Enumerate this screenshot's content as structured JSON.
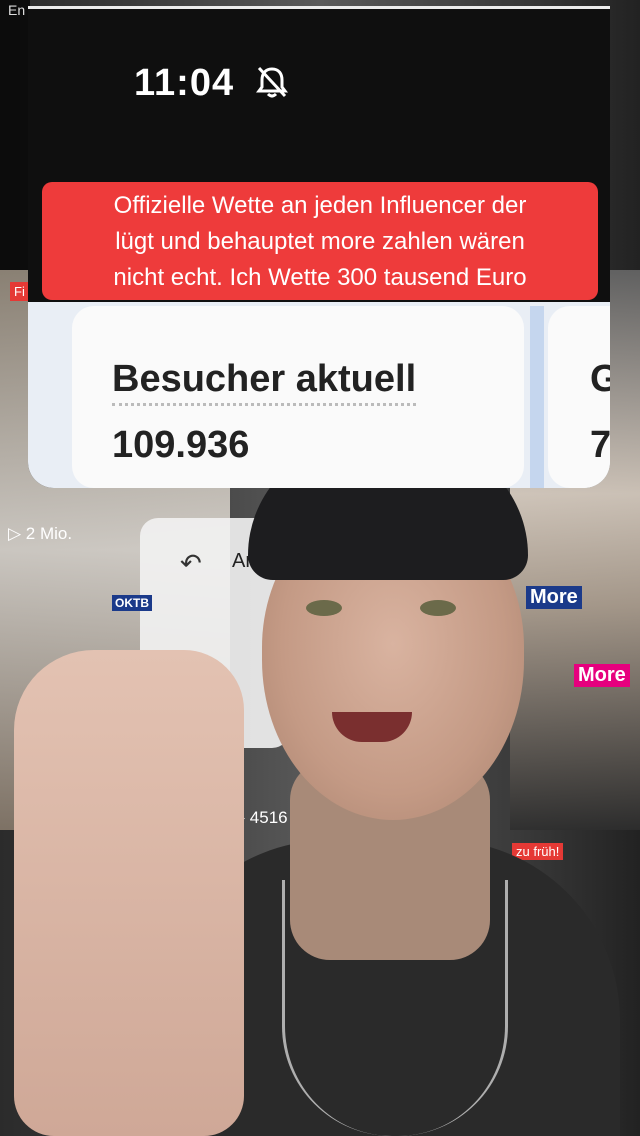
{
  "phone_status": {
    "time": "11:04",
    "icon": "bell-muted-icon"
  },
  "caption": {
    "line1": "Offizielle Wette an jeden Influencer der",
    "line2": "lügt und behauptet more zahlen wären",
    "line3": "nicht echt. Ich Wette 300 tausend Euro"
  },
  "stats_card": {
    "label": "Besucher aktuell",
    "value": "109.936",
    "next_label_partial": "G",
    "next_value_partial": "7"
  },
  "background_snippets": {
    "top_left": "En",
    "tag_left": "Fi",
    "views_left": "▷ 2 Mio.",
    "views_mid": "▷ 4516",
    "card_text": "An",
    "tag_right": "zu früh!",
    "brand_1": "More",
    "brand_2": "More",
    "event_label": "OKTB"
  },
  "colors": {
    "caption_bg": "#ee3b3b",
    "caption_text": "#ffffff",
    "card_bg": "#fafafa"
  }
}
